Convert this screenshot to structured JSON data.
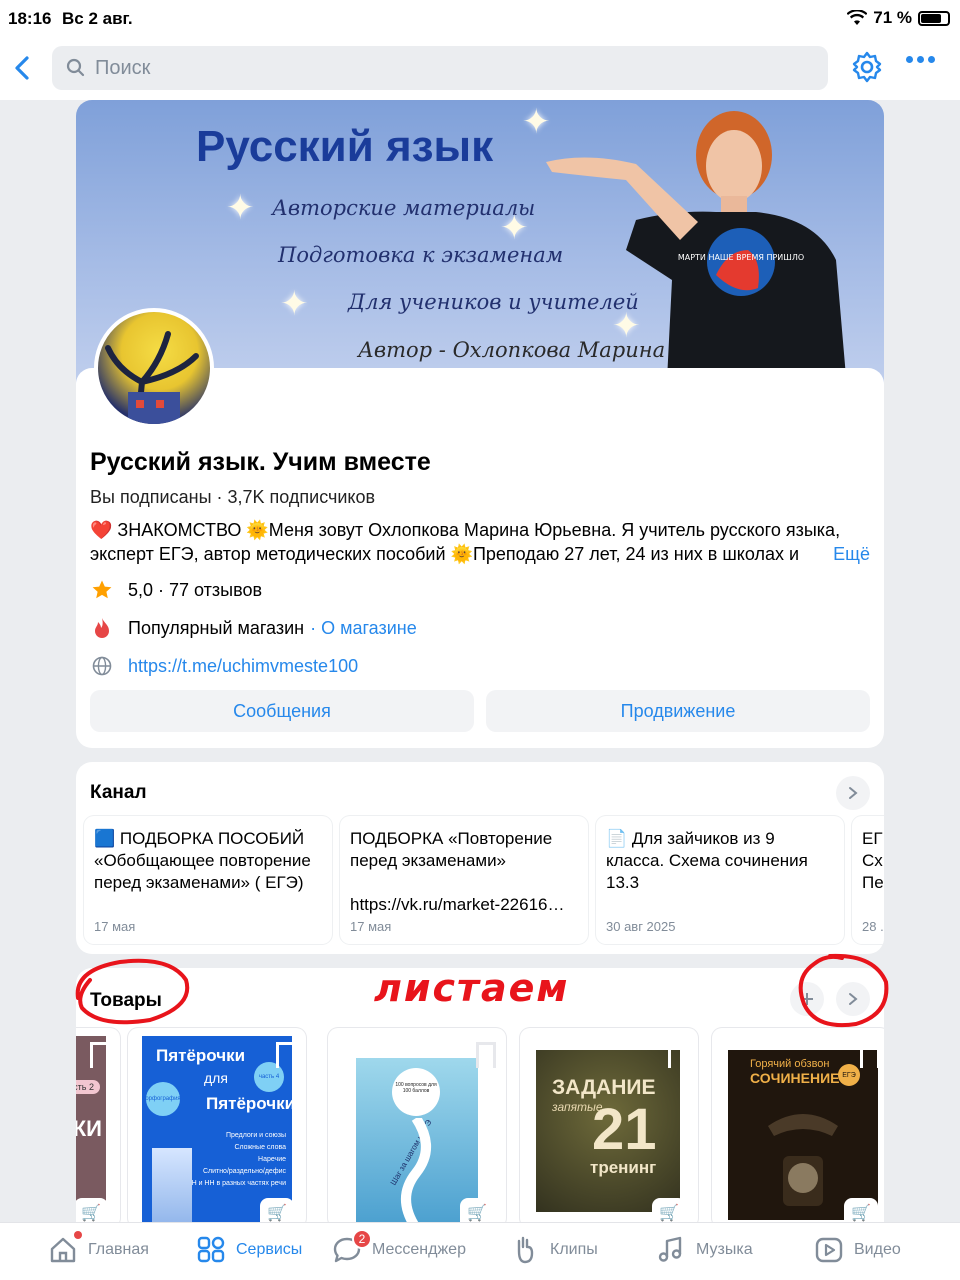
{
  "status": {
    "time": "18:16",
    "date": "Вс 2 авг.",
    "battery": "71 %"
  },
  "search": {
    "placeholder": "Поиск"
  },
  "cover": {
    "title": "Русский язык",
    "lines": [
      "Авторские материалы",
      "Подготовка к экзаменам",
      "Для учеников и учителей"
    ],
    "author": "Автор - Охлопкова Марина",
    "tshirt": "МАРТИ НАШЕ ВРЕМЯ ПРИШЛО"
  },
  "profile": {
    "name": "Русский язык. Учим вместе",
    "subscribed": "Вы подписаны · 3,7K подписчиков",
    "description": "❤️ ЗНАКОМСТВО 🌞Меня зовут Охлопкова Марина Юрьевна. Я учитель русского языка, эксперт ЕГЭ, автор методических пособий 🌞Преподаю 27 лет, 24 из них в школах и",
    "more": "Ещё",
    "rating": "5,0 · 77 отзывов",
    "shop": "Популярный магазин",
    "shop_link": "· О магазине",
    "url": "https://t.me/uchimvmeste100",
    "btn_messages": "Сообщения",
    "btn_promo": "Продвижение"
  },
  "channel": {
    "title": "Канал",
    "posts": [
      {
        "text": "🟦 ПОДБОРКА ПОСОБИЙ «Обобщающее повторение перед экзаменами» ( ЕГЭ)",
        "date": "17 мая"
      },
      {
        "text": "ПОДБОРКА «Повторение перед экзаменами»\n\nhttps://vk.ru/market-22616…",
        "date": "17 мая"
      },
      {
        "text": "📄 Для зайчиков из 9 класса. Схема сочинения 13.3",
        "date": "30 авг 2025"
      },
      {
        "text": "ЕГ Сх Пе",
        "date": "28 ."
      }
    ]
  },
  "goods": {
    "title": "Товары",
    "scribble": "листаем",
    "products": [
      {
        "c1": "асть 2",
        "c2": "ЧКИ"
      },
      {
        "c1": "Пятёрочки",
        "c2": "для",
        "c3": "Пятёрочки",
        "c4": "Предлоги и союзы",
        "c5": "Сложные слова",
        "c6": "Наречие",
        "c7": "Слитно/раздельно/дефис",
        "c8": "Н и НН в разных частях речи",
        "c9": "часть 4",
        "c10": "орфография"
      },
      {
        "c1": "100 вопросов для 100 баллов",
        "c2": "Шаг за шагом к ЕГЭ"
      },
      {
        "c1": "ЗАДАНИЕ",
        "c2": "запятые",
        "c3": "21",
        "c4": "тренинг"
      },
      {
        "c1": "Горячий обзвон",
        "c2": "СОЧИНЕНИЕ",
        "c3": "ЕГЭ"
      }
    ]
  },
  "tabs": [
    "Главная",
    "Сервисы",
    "Мессенджер",
    "Клипы",
    "Музыка",
    "Видео"
  ],
  "messenger_badge": "2",
  "colors": {
    "accent": "#2688eb",
    "badge": "#e64646",
    "scribble": "#e8141b"
  }
}
